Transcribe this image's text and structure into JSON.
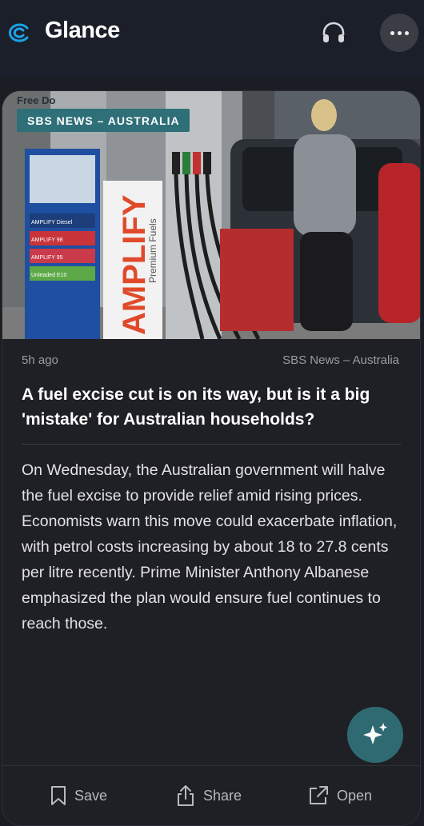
{
  "app": {
    "title": "Glance"
  },
  "header_icons": [
    "glance-logo-icon",
    "headphones-icon",
    "more-icon"
  ],
  "article": {
    "badge": "SBS NEWS – AUSTRALIA",
    "time": "5h ago",
    "source": "SBS News – Australia",
    "headline": "A fuel excise cut is on its way, but is it a big 'mistake' for Australian households?",
    "summary": "On Wednesday, the Australian government will halve the fuel excise to provide relief amid rising prices. Economists warn this move could exacerbate inflation, with petrol costs increasing by about 18 to 27.8 cents per litre recently. Prime Minister Anthony Albanese emphasized the plan would ensure fuel continues to reach those."
  },
  "image": {
    "signage": {
      "top": "Free Do",
      "brand": "AMPLIFY",
      "sub": "Premium Fuels",
      "price_rows": [
        "AMPLIFY Diesel",
        "AMPLIFY 98",
        "AMPLIFY 95",
        "Unleaded E10"
      ]
    }
  },
  "actions": {
    "save": "Save",
    "share": "Share",
    "open": "Open"
  },
  "colors": {
    "accent": "#2f6a73",
    "background": "#1a1d24",
    "card": "#1f2026"
  }
}
